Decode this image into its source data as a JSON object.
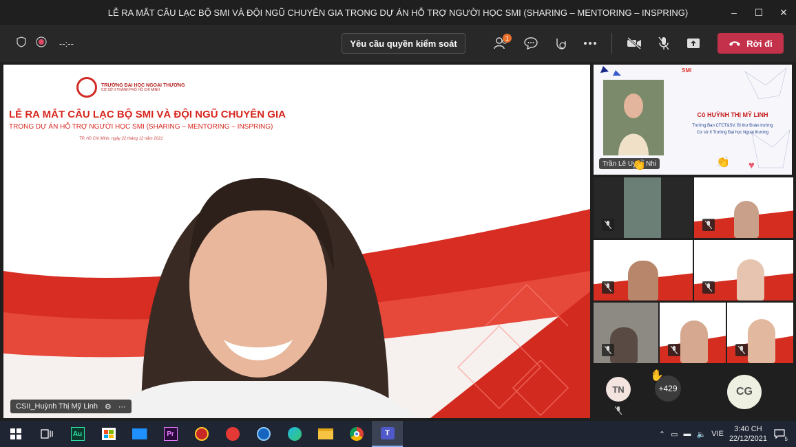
{
  "window": {
    "title": "LỄ RA MẮT CÂU LẠC BỘ SMI VÀ ĐỘI NGŨ CHUYÊN GIA TRONG DỰ ÁN HỖ TRỢ NGƯỜI HỌC SMI (SHARING – MENTORING – INSPRING)",
    "controls": [
      "–",
      "☐",
      "✕"
    ]
  },
  "toolbar": {
    "timer": "--:--",
    "request_control": "Yêu cầu quyền kiểm soát",
    "participants_badge": "1",
    "leave_label": "Rời đi"
  },
  "stage": {
    "slide_header_small": "TRƯỜNG ĐẠI HỌC NGOẠI THƯƠNG",
    "slide_header_sub": "CƠ SỞ II THÀNH PHỐ HỒ CHÍ MINH",
    "slide_title": "LỄ RA MẮT CÂU LẠC BỘ SMI VÀ ĐỘI NGŨ CHUYÊN GIA",
    "slide_subtitle": "TRONG DỰ ÁN HỖ TRỢ NGƯỜI HỌC SMI (SHARING – MENTORING – INSPRING)",
    "slide_date": "TP. Hồ Chí Minh, ngày 22 tháng 12 năm 2021",
    "speaker_label": "CSII_Huỳnh Thị Mỹ Linh"
  },
  "featured": {
    "brand": "SMI",
    "name": "Cô HUỲNH THỊ MỸ LINH",
    "role_line1": "Trưởng Ban CTCT&SV, Bí thư Đoàn trường",
    "role_line2": "Cơ sở II Trường Đại học Ngoại thương",
    "participant_label": "Trần Lê Uyên Nhi"
  },
  "gallery": {
    "avatars": [
      {
        "initials": "TN",
        "color": "#f3e4df"
      },
      {
        "initials": "CG",
        "color": "#eef0e2"
      }
    ],
    "more_count": "+429"
  },
  "taskbar": {
    "apps": [
      "windows-start",
      "task-view",
      "audition",
      "store",
      "mail",
      "premiere",
      "app-red-1",
      "app-red-2",
      "app-blue",
      "edge",
      "file-explorer",
      "chrome",
      "teams"
    ],
    "lang": "VIE",
    "time": "3:40 CH",
    "date": "22/12/2021",
    "notif_count": "5"
  }
}
